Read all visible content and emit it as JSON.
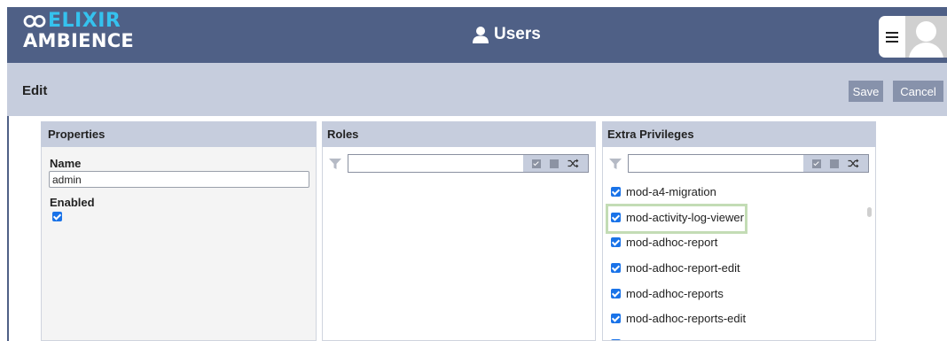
{
  "header": {
    "logo_top": "ELIXIR",
    "logo_bottom": "AMBIENCE",
    "title": "Users"
  },
  "subbar": {
    "title": "Edit",
    "save_label": "Save",
    "cancel_label": "Cancel"
  },
  "properties": {
    "header": "Properties",
    "name_label": "Name",
    "name_value": "admin",
    "enabled_label": "Enabled",
    "enabled": true
  },
  "roles": {
    "header": "Roles",
    "filter_value": ""
  },
  "extra_privileges": {
    "header": "Extra Privileges",
    "filter_value": "",
    "items": [
      {
        "label": "mod-a4-migration",
        "checked": true
      },
      {
        "label": "mod-activity-log-viewer",
        "checked": true
      },
      {
        "label": "mod-adhoc-report",
        "checked": true
      },
      {
        "label": "mod-adhoc-report-edit",
        "checked": true
      },
      {
        "label": "mod-adhoc-reports",
        "checked": true
      },
      {
        "label": "mod-adhoc-reports-edit",
        "checked": true
      }
    ]
  },
  "colors": {
    "header_bg": "#4f6086",
    "subbar_bg": "#c6cddd",
    "accent_logo": "#35c2ee",
    "button_bg": "#8792ab",
    "checkbox": "#1a73e8",
    "highlight": "#c3dcb5"
  },
  "icons": {
    "menu": "hamburger-icon",
    "avatar": "user-avatar-icon",
    "title": "user-icon",
    "filter": "funnel-icon",
    "select_all": "check-all-icon",
    "select_none": "square-icon",
    "invert": "shuffle-icon"
  }
}
